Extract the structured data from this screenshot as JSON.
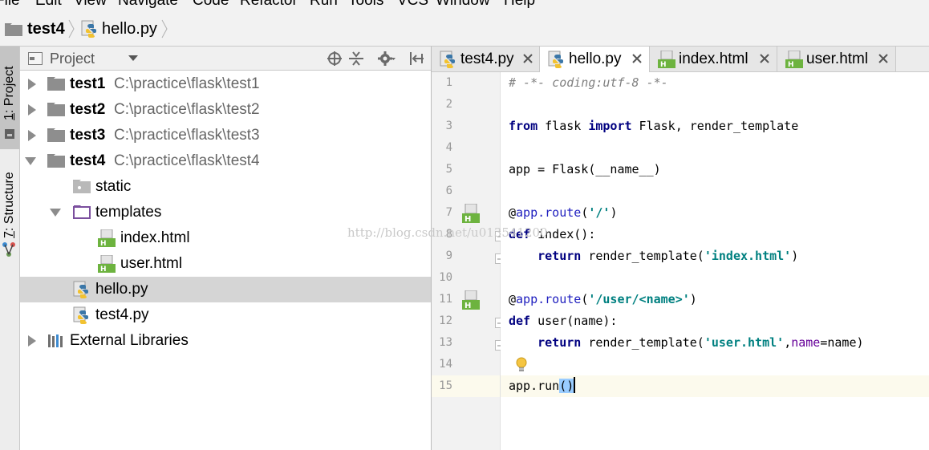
{
  "menu": {
    "items": [
      "File",
      "Edit",
      "View",
      "Navigate",
      "Code",
      "Refactor",
      "Run",
      "Tools",
      "VCS",
      "Window",
      "Help"
    ]
  },
  "navbar": {
    "crumbs": [
      "test4",
      "hello.py"
    ]
  },
  "tool_tabs": {
    "project": {
      "num": "1",
      "text": ": Project"
    },
    "structure": {
      "num": "7",
      "text": ": Structure"
    }
  },
  "project_panel": {
    "title": "Project",
    "header_icons": [
      "crosshair-icon",
      "collapse-icon",
      "gear-icon",
      "hide-panel-icon"
    ]
  },
  "tree": [
    {
      "label": "test1",
      "path": "C:\\practice\\flask\\test1",
      "bold": true,
      "icon": "folder",
      "arrow": "right"
    },
    {
      "label": "test2",
      "path": "C:\\practice\\flask\\test2",
      "bold": true,
      "icon": "folder",
      "arrow": "right"
    },
    {
      "label": "test3",
      "path": "C:\\practice\\flask\\test3",
      "bold": true,
      "icon": "folder",
      "arrow": "right"
    },
    {
      "label": "test4",
      "path": "C:\\practice\\flask\\test4",
      "bold": true,
      "icon": "folder",
      "arrow": "down"
    },
    {
      "label": "static",
      "path": "",
      "bold": false,
      "icon": "folder-light"
    },
    {
      "label": "templates",
      "path": "",
      "bold": false,
      "icon": "folder-template",
      "arrow": "down"
    },
    {
      "label": "index.html",
      "path": "",
      "bold": false,
      "icon": "html-file"
    },
    {
      "label": "user.html",
      "path": "",
      "bold": false,
      "icon": "html-file"
    },
    {
      "label": "hello.py",
      "path": "",
      "bold": false,
      "icon": "python-file",
      "selected": true
    },
    {
      "label": "test4.py",
      "path": "",
      "bold": false,
      "icon": "python-file"
    },
    {
      "label": "External Libraries",
      "path": "",
      "bold": false,
      "icon": "library",
      "arrow": "right"
    }
  ],
  "editor": {
    "tabs": [
      {
        "label": "test4.py",
        "icon": "python-file",
        "active": false
      },
      {
        "label": "hello.py",
        "icon": "python-file",
        "active": true
      },
      {
        "label": "index.html",
        "icon": "html-file",
        "active": false
      },
      {
        "label": "user.html",
        "icon": "html-file",
        "active": false
      }
    ],
    "line_numbers": [
      "1",
      "2",
      "3",
      "4",
      "5",
      "6",
      "7",
      "8",
      "9",
      "10",
      "11",
      "12",
      "13",
      "14",
      "15"
    ],
    "current_line": "15",
    "code": [
      [
        [
          "comment",
          "# -*- coding:utf-8 -*-"
        ]
      ],
      [],
      [
        [
          "kw",
          "from"
        ],
        [
          "plain",
          " flask "
        ],
        [
          "kw",
          "import"
        ],
        [
          "plain",
          " Flask, render_template"
        ]
      ],
      [],
      [
        [
          "plain",
          "app = Flask(__name__)"
        ]
      ],
      [],
      [
        [
          "plain",
          "@"
        ],
        [
          "deco",
          "app.route"
        ],
        [
          "plain",
          "("
        ],
        [
          "str",
          "'/'"
        ],
        [
          "plain",
          ")"
        ]
      ],
      [
        [
          "kw",
          "def"
        ],
        [
          "plain",
          " index():"
        ]
      ],
      [
        [
          "plain",
          "    "
        ],
        [
          "kw",
          "return"
        ],
        [
          "plain",
          " render_template("
        ],
        [
          "str",
          "'index.html'"
        ],
        [
          "plain",
          ")"
        ]
      ],
      [],
      [
        [
          "plain",
          "@"
        ],
        [
          "deco",
          "app.route"
        ],
        [
          "plain",
          "("
        ],
        [
          "str",
          "'/user/<name>'"
        ],
        [
          "plain",
          ")"
        ]
      ],
      [
        [
          "kw",
          "def"
        ],
        [
          "plain",
          " user(name):"
        ]
      ],
      [
        [
          "plain",
          "    "
        ],
        [
          "kw",
          "return"
        ],
        [
          "plain",
          " render_template("
        ],
        [
          "str",
          "'user.html'"
        ],
        [
          "plain",
          ","
        ],
        [
          "param",
          "name"
        ],
        [
          "plain",
          "=name)"
        ]
      ],
      [],
      [
        [
          "plain",
          "app.run"
        ],
        [
          "brace",
          "("
        ],
        [
          "brace",
          ")"
        ],
        [
          "caret",
          ""
        ]
      ]
    ]
  },
  "watermark": "http://blog.csdn.net/u013541200",
  "colors": {
    "keyword": "#000080",
    "string": "#008080",
    "comment": "#808080",
    "selection": "#d5d5d5",
    "current_line": "#fcfaed"
  }
}
